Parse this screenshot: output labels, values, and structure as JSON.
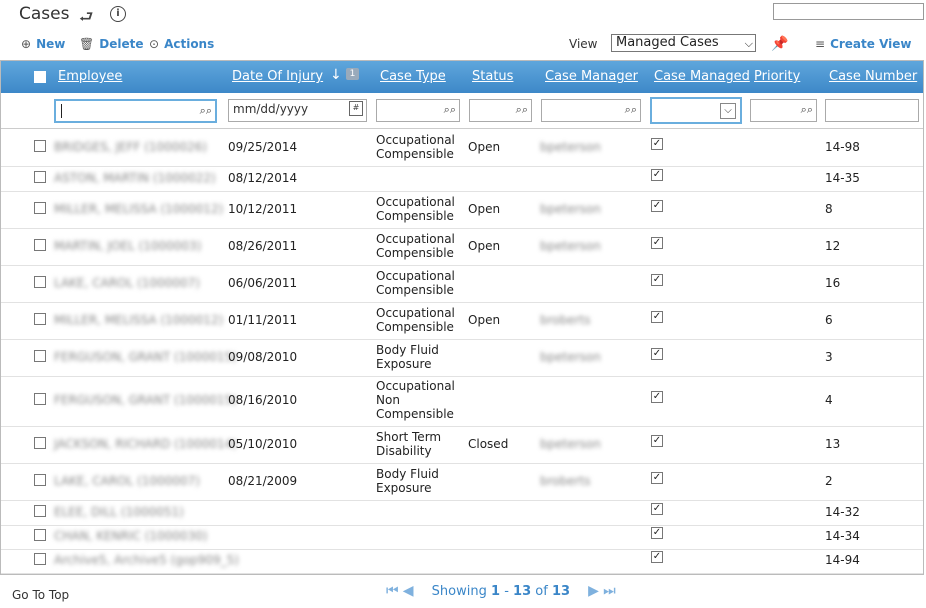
{
  "page": {
    "title": "Cases"
  },
  "toolbar": {
    "new_label": "New",
    "delete_label": "Delete",
    "actions_label": "Actions",
    "view_label": "View",
    "view_selected": "Managed Cases",
    "create_view_label": "Create View"
  },
  "columns": [
    {
      "label": "Employee"
    },
    {
      "label": "Date Of Injury"
    },
    {
      "label": "Case Type"
    },
    {
      "label": "Status"
    },
    {
      "label": "Case Manager"
    },
    {
      "label": "Case Managed"
    },
    {
      "label": "Priority"
    },
    {
      "label": "Case Number"
    }
  ],
  "sort": {
    "badge": "1"
  },
  "filters": {
    "date_placeholder": "mm/dd/yyyy"
  },
  "rows": [
    {
      "employee": "BRIDGES, JEFF (1000026)",
      "date": "09/25/2014",
      "type": [
        "Occupational",
        "Compensible"
      ],
      "status": "Open",
      "manager": "bpeterson",
      "number": "14-98"
    },
    {
      "employee": "ASTON, MARTIN (1000022)",
      "date": "08/12/2014",
      "type": [],
      "status": "",
      "manager": "",
      "number": "14-35"
    },
    {
      "employee": "MILLER, MELISSA (1000012)",
      "date": "10/12/2011",
      "type": [
        "Occupational",
        "Compensible"
      ],
      "status": "Open",
      "manager": "bpeterson",
      "number": "8"
    },
    {
      "employee": "MARTIN, JOEL (1000003)",
      "date": "08/26/2011",
      "type": [
        "Occupational",
        "Compensible"
      ],
      "status": "Open",
      "manager": "bpeterson",
      "number": "12"
    },
    {
      "employee": "LAKE, CAROL (1000007)",
      "date": "06/06/2011",
      "type": [
        "Occupational",
        "Compensible"
      ],
      "status": "",
      "manager": "",
      "number": "16"
    },
    {
      "employee": "MILLER, MELISSA (1000012)",
      "date": "01/11/2011",
      "type": [
        "Occupational",
        "Compensible"
      ],
      "status": "Open",
      "manager": "broberts",
      "number": "6"
    },
    {
      "employee": "FERGUSON, GRANT (1000015)",
      "date": "09/08/2010",
      "type": [
        "Body Fluid",
        "Exposure"
      ],
      "status": "",
      "manager": "bpeterson",
      "number": "3"
    },
    {
      "employee": "FERGUSON, GRANT (1000015)",
      "date": "08/16/2010",
      "type": [
        "Occupational",
        "Non",
        "Compensible"
      ],
      "status": "",
      "manager": "",
      "number": "4"
    },
    {
      "employee": "JACKSON, RICHARD (1000014)",
      "date": "05/10/2010",
      "type": [
        "Short Term",
        "Disability"
      ],
      "status": "Closed",
      "manager": "bpeterson",
      "number": "13"
    },
    {
      "employee": "LAKE, CAROL (1000007)",
      "date": "08/21/2009",
      "type": [
        "Body Fluid",
        "Exposure"
      ],
      "status": "",
      "manager": "broberts",
      "number": "2"
    },
    {
      "employee": "ELEE, DILL (1000051)",
      "date": "",
      "type": [],
      "status": "",
      "manager": "",
      "number": "14-32"
    },
    {
      "employee": "CHAN, KENRIC (1000030)",
      "date": "",
      "type": [],
      "status": "",
      "manager": "",
      "number": "14-34"
    },
    {
      "employee": "Archive5, Archive5 (gop909_5)",
      "date": "",
      "type": [],
      "status": "",
      "manager": "",
      "number": "14-94"
    }
  ],
  "footer": {
    "go_to_top": "Go To Top",
    "showing_prefix": "Showing",
    "range_start": "1",
    "range_sep": "-",
    "range_end": "13",
    "of": "of",
    "total": "13"
  }
}
